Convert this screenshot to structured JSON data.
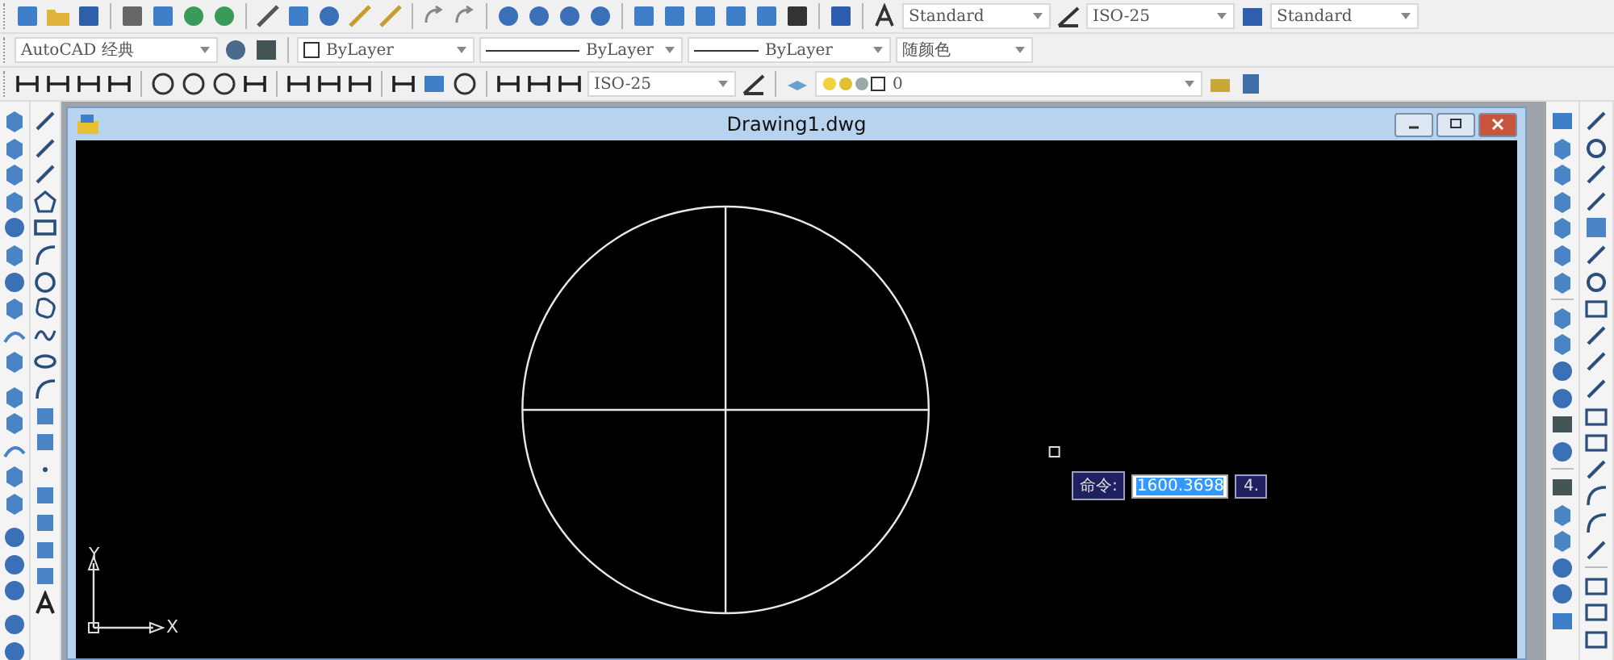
{
  "toolbars": {
    "styles": [
      {
        "kind": "text",
        "value": "Standard"
      },
      {
        "kind": "dimension",
        "value": "ISO-25"
      },
      {
        "kind": "table",
        "value": "Standard"
      }
    ],
    "workspace": {
      "value": "AutoCAD 经典"
    },
    "properties": [
      {
        "kind": "color",
        "value": "ByLayer"
      },
      {
        "kind": "linetype",
        "value": "ByLayer"
      },
      {
        "kind": "lineweight",
        "value": "ByLayer"
      },
      {
        "kind": "plotstyle",
        "value": "随颜色"
      }
    ],
    "dimension_style": {
      "value": "ISO-25"
    },
    "layer": {
      "value": "0"
    }
  },
  "window": {
    "title": "Drawing1.dwg"
  },
  "command_input": {
    "label": "命令:",
    "value": "1600.3698",
    "value_2": "4."
  },
  "ucs": {
    "y_label": "Y",
    "x_label": "X"
  }
}
